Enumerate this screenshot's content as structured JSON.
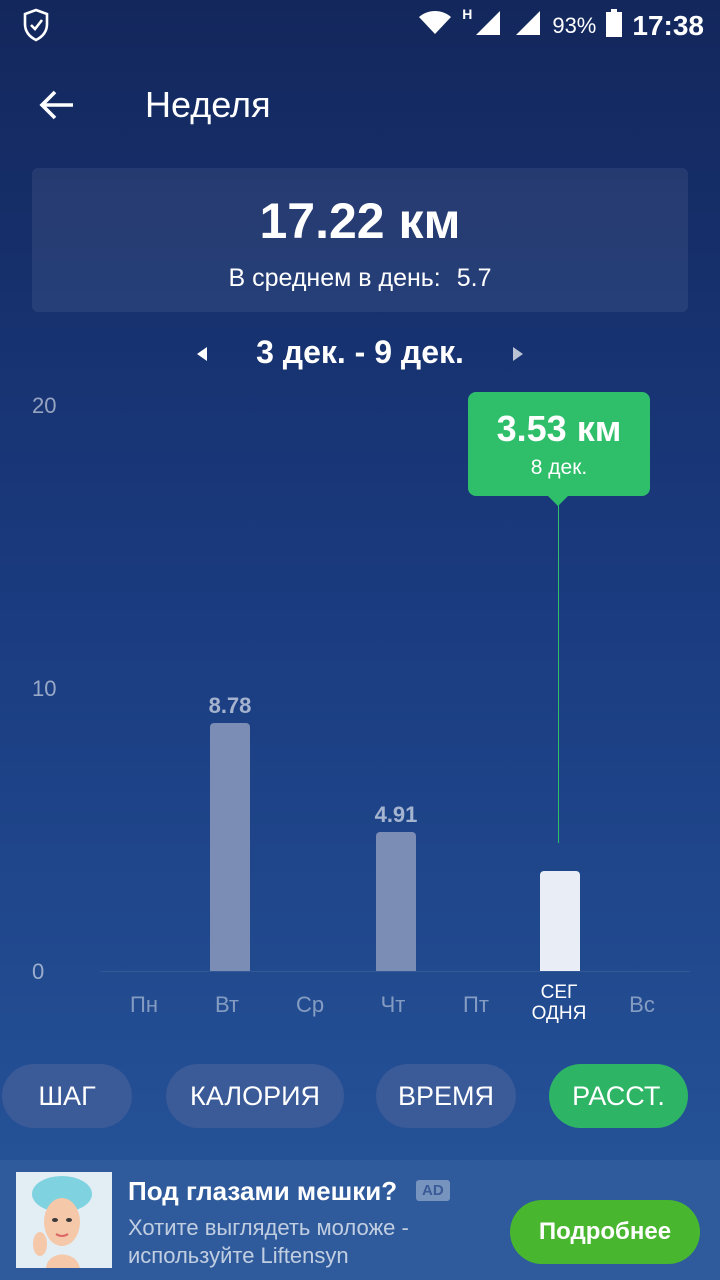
{
  "status_bar": {
    "network_label": "H",
    "battery": "93%",
    "time": "17:38",
    "icons": [
      "shield-check-icon",
      "wifi-icon",
      "signal-icon",
      "battery-icon"
    ]
  },
  "header": {
    "title": "Неделя"
  },
  "summary": {
    "total": "17.22 км",
    "avg_label": "В среднем в день:",
    "avg_value": "5.7"
  },
  "date_range": {
    "label": "3 дек. - 9 дек."
  },
  "chart_data": {
    "type": "bar",
    "categories": [
      "Пн",
      "Вт",
      "Ср",
      "Чт",
      "Пт",
      "СЕГОДНЯ",
      "Вс"
    ],
    "category_labels": [
      "Пн",
      "Вт",
      "Ср",
      "Чт",
      "Пт",
      "СЕГ\nОДНЯ",
      "Вс"
    ],
    "values": [
      0,
      8.78,
      0,
      4.91,
      0,
      3.53,
      0
    ],
    "value_labels": [
      "",
      "8.78",
      "",
      "4.91",
      "",
      "",
      ""
    ],
    "y_ticks": [
      "20",
      "10",
      "0"
    ],
    "ylim": [
      0,
      20
    ],
    "highlight_index": 5,
    "tooltip": {
      "value": "3.53 км",
      "date": "8 дек."
    },
    "colors": {
      "bar": "#7b8db5",
      "today_bar": "#e9edf5",
      "highlight": "#2fbf6a"
    }
  },
  "tabs": [
    {
      "label": "ШАГ",
      "active": false
    },
    {
      "label": "КАЛОРИЯ",
      "active": false
    },
    {
      "label": "ВРЕМЯ",
      "active": false
    },
    {
      "label": "РАССТ.",
      "active": true
    }
  ],
  "ad": {
    "title": "Под глазами мешки?",
    "badge": "AD",
    "text": "Хотите выглядеть моложе - используйте Liftensyn",
    "button": "Подробнее"
  },
  "colors": {
    "accent": "#2fbf6a",
    "background": "#1a3a7e"
  }
}
